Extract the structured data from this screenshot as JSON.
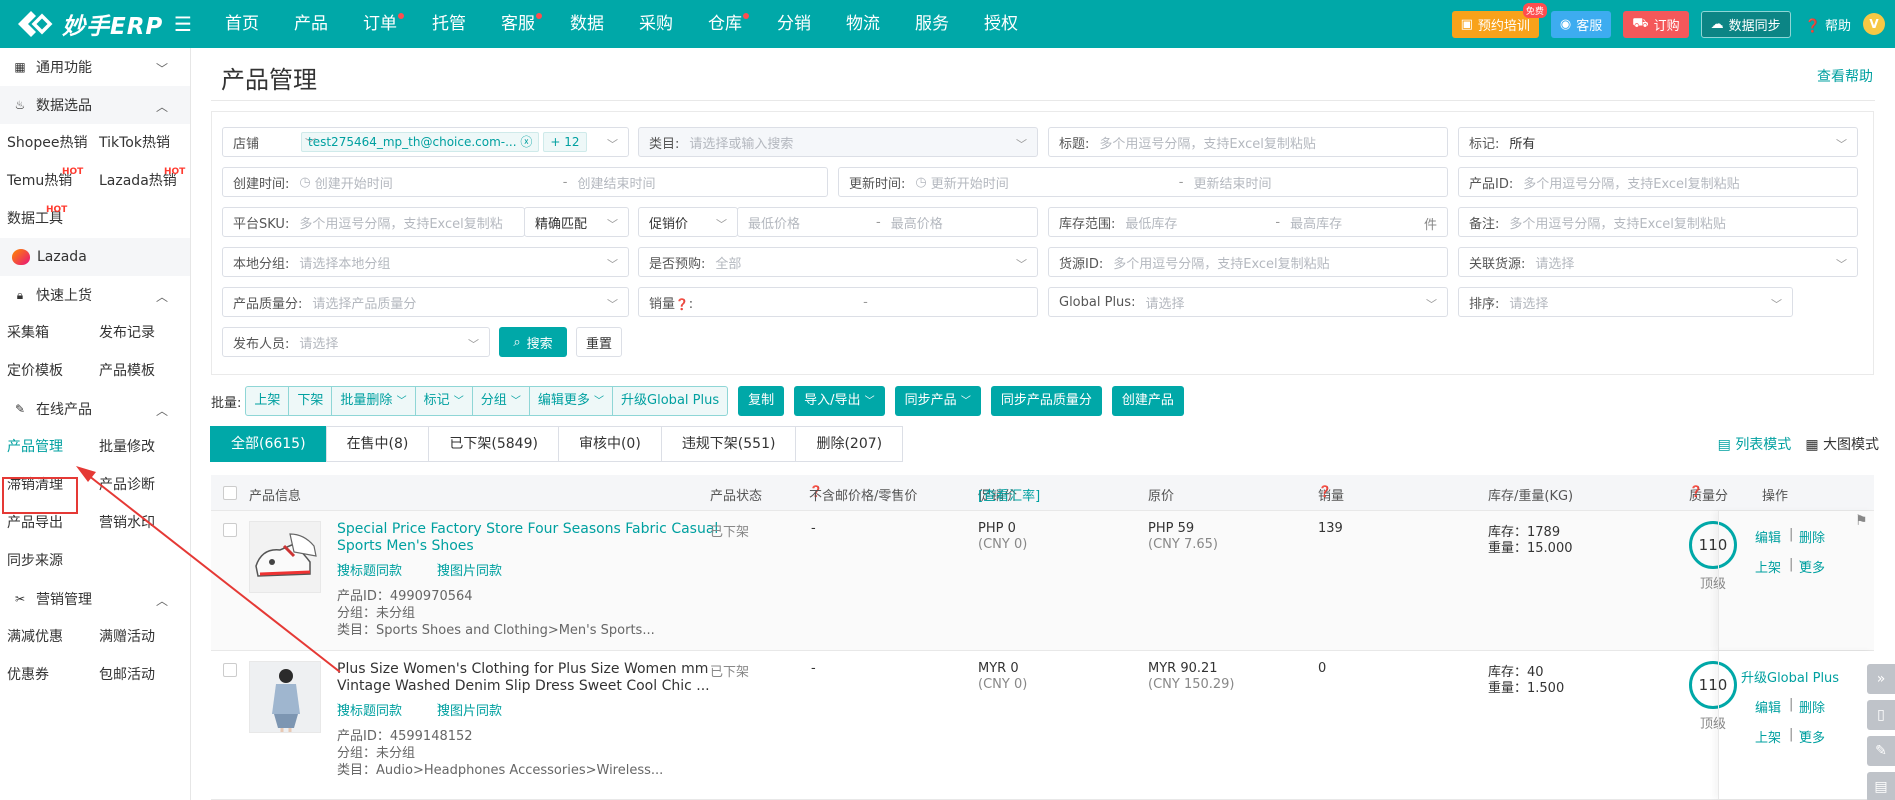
{
  "topbar": {
    "logo_text": "妙手ERP",
    "nav": [
      "首页",
      "产品",
      "订单",
      "托管",
      "客服",
      "数据",
      "采购",
      "仓库",
      "分销",
      "物流",
      "服务",
      "授权"
    ],
    "nav_dots": [
      false,
      false,
      true,
      false,
      true,
      false,
      false,
      true,
      false,
      false,
      false,
      false
    ],
    "training_label": "预约培训",
    "training_badge": "免费",
    "service_label": "客服",
    "order_label": "订购",
    "sync_label": "数据同步",
    "help_label": "帮助",
    "avatar_letter": "V"
  },
  "sidebar": {
    "general": "通用功能",
    "data_select": "数据选品",
    "data_items": [
      "Shopee热销",
      "TikTok热销",
      "Temu热销",
      "Lazada热销",
      "数据工具"
    ],
    "hot": "HOT",
    "lazada": "Lazada",
    "quick_upload": "快速上货",
    "quick_items": [
      "采集箱",
      "发布记录",
      "定价模板",
      "产品模板"
    ],
    "online": "在线产品",
    "online_items": [
      "产品管理",
      "批量修改",
      "滞销清理",
      "产品诊断",
      "产品导出",
      "营销水印",
      "同步来源"
    ],
    "marketing": "营销管理",
    "marketing_items": [
      "满减优惠",
      "满赠活动",
      "优惠券",
      "包邮活动"
    ]
  },
  "page": {
    "title": "产品管理",
    "help": "查看帮助"
  },
  "filters": {
    "store_label": "店铺",
    "store_tag": "test275464_mp_th@choice.com-...",
    "store_more": "+ 12",
    "category_label": "类目:",
    "category_ph": "请选择或输入搜索",
    "title_label": "标题:",
    "title_ph": "多个用逗号分隔，支持Excel复制粘贴",
    "mark_label": "标记:",
    "mark_val": "所有",
    "create_label": "创建时间:",
    "create_start": "创建开始时间",
    "create_end": "创建结束时间",
    "update_label": "更新时间:",
    "update_start": "更新开始时间",
    "update_end": "更新结束时间",
    "pid_label": "产品ID:",
    "pid_ph": "多个用逗号分隔，支持Excel复制粘贴",
    "sku_label": "平台SKU:",
    "sku_ph": "多个用逗号分隔，支持Excel复制粘",
    "sku_match": "精确匹配",
    "promo_label": "促销价",
    "promo_min": "最低价格",
    "promo_max": "最高价格",
    "stock_label": "库存范围:",
    "stock_min": "最低库存",
    "stock_max": "最高库存",
    "stock_unit": "件",
    "note_label": "备注:",
    "note_ph": "多个用逗号分隔，支持Excel复制粘贴",
    "group_label": "本地分组:",
    "group_ph": "请选择本地分组",
    "presale_label": "是否预购:",
    "presale_val": "全部",
    "source_label": "货源ID:",
    "source_ph": "多个用逗号分隔，支持Excel复制粘贴",
    "link_label": "关联货源:",
    "link_ph": "请选择",
    "quality_label": "产品质量分:",
    "quality_ph": "请选择产品质量分",
    "sales_label": "销量",
    "global_label": "Global Plus:",
    "global_ph": "请选择",
    "sort_label": "排序:",
    "sort_ph": "请选择",
    "publisher_label": "发布人员:",
    "publisher_ph": "请选择",
    "search": "搜索",
    "reset": "重置",
    "dash": "-"
  },
  "batch": {
    "label": "批量:",
    "group": [
      "上架",
      "下架",
      "批量删除",
      "标记",
      "分组",
      "编辑更多",
      "升级Global Plus"
    ],
    "solids": [
      "复制",
      "导入/导出",
      "同步产品",
      "同步产品质量分",
      "创建产品"
    ]
  },
  "tabs": [
    "全部(6615)",
    "在售中(8)",
    "已下架(5849)",
    "审核中(0)",
    "违规下架(551)",
    "删除(207)"
  ],
  "view": {
    "list": "列表模式",
    "big": "大图模式"
  },
  "table": {
    "headers": [
      "产品信息",
      "产品状态",
      "不含邮价格/零售价",
      "促销价",
      "[查看汇率]",
      "原价",
      "销量",
      "库存/重量(KG)",
      "质量分",
      "操作"
    ],
    "rows": [
      {
        "name_1": "Special Price Factory Store Four Seasons Fabric Casual",
        "name_2": "Sports Men's Shoes",
        "same_title": "搜标题同款",
        "same_image": "搜图片同款",
        "pid": "产品ID：4990970564",
        "group": "分组：未分组",
        "category": "类目：Sports Shoes and Clothing>Men's Sports...",
        "status": "已下架",
        "price": "-",
        "promo": "PHP 0",
        "promo_cny": "(CNY 0)",
        "orig": "PHP 59",
        "orig_cny": "(CNY 7.65)",
        "sales": "139",
        "stock": "库存：1789",
        "weight": "重量：15.000",
        "score": "110",
        "level": "顶级",
        "ops": [
          "编辑",
          "删除",
          "上架",
          "更多"
        ]
      },
      {
        "name_1": "Plus Size Women's Clothing for Plus Size Women mm",
        "name_2": "Vintage Washed Denim Slip Dress Sweet Cool Chic ...",
        "same_title": "搜标题同款",
        "same_image": "搜图片同款",
        "pid": "产品ID：4599148152",
        "group": "分组：未分组",
        "category": "类目：Audio>Headphones Accessories>Wireless...",
        "status": "已下架",
        "price": "-",
        "promo": "MYR 0",
        "promo_cny": "(CNY 0)",
        "orig": "MYR 90.21",
        "orig_cny": "(CNY 150.29)",
        "sales": "0",
        "stock": "库存：40",
        "weight": "重量：1.500",
        "score": "110",
        "level": "顶级",
        "upgrade": "升级Global Plus",
        "ops": [
          "编辑",
          "删除",
          "上架",
          "更多"
        ]
      }
    ]
  },
  "colors": {
    "brand": "#00a8a8",
    "highlight": "#e53935"
  }
}
